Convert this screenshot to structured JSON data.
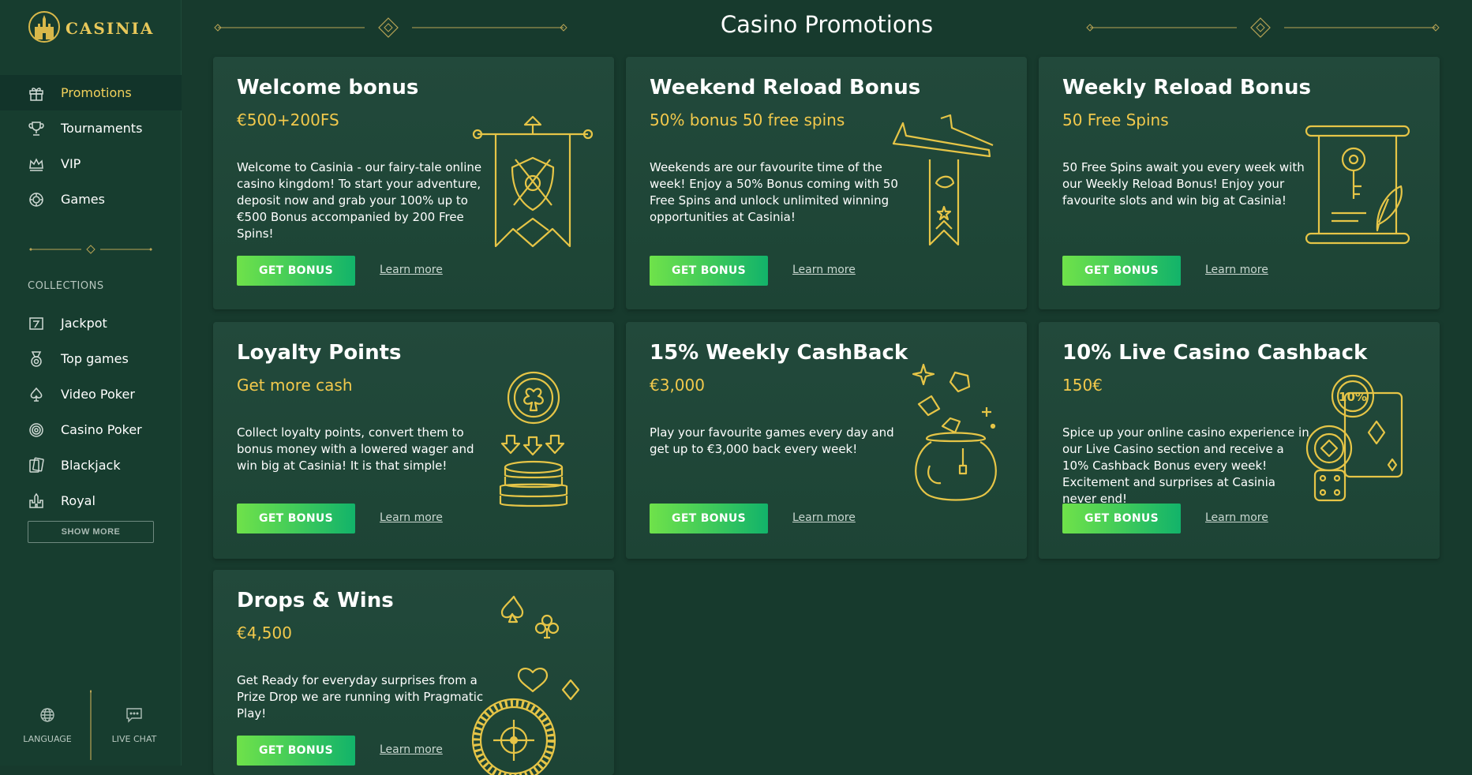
{
  "brand": {
    "logo_text": "CASINIA"
  },
  "nav": {
    "items": [
      {
        "label": "Promotions",
        "icon": "gift-icon",
        "active": true
      },
      {
        "label": "Tournaments",
        "icon": "trophy-icon"
      },
      {
        "label": "VIP",
        "icon": "crown-icon"
      },
      {
        "label": "Games",
        "icon": "chip-icon"
      }
    ]
  },
  "collections": {
    "title": "COLLECTIONS",
    "items": [
      {
        "label": "Jackpot",
        "icon": "slot-seven-icon"
      },
      {
        "label": "Top games",
        "icon": "medal-icon"
      },
      {
        "label": "Video Poker",
        "icon": "spade-icon"
      },
      {
        "label": "Casino Poker",
        "icon": "poker-chip-icon"
      },
      {
        "label": "Blackjack",
        "icon": "cards-icon"
      },
      {
        "label": "Royal",
        "icon": "castle-icon"
      }
    ],
    "show_more": "SHOW MORE"
  },
  "bottom": {
    "language": "LANGUAGE",
    "live_chat": "LIVE CHAT"
  },
  "page": {
    "title": "Casino Promotions"
  },
  "promotions": [
    {
      "title": "Welcome bonus",
      "subtitle": "€500+200FS",
      "description": "Welcome to Casinia - our fairy-tale online casino kingdom! To start your adventure, deposit now and grab your 100% up to €500 Bonus accompanied by 200 Free Spins!",
      "button": "GET BONUS",
      "link": "Learn more",
      "art": "banner-shield-icon"
    },
    {
      "title": "Weekend Reload Bonus",
      "subtitle": "50% bonus 50 free spins",
      "description": "Weekends are our favourite time of the week! Enjoy a 50% Bonus coming with 50 Free Spins and unlock unlimited winning opportunities at Casinia!",
      "button": "GET BONUS",
      "link": "Learn more",
      "art": "trumpets-banner-icon"
    },
    {
      "title": "Weekly Reload Bonus",
      "subtitle": "50 Free Spins",
      "description": "50 Free Spins await you every week with our Weekly Reload Bonus! Enjoy your favourite slots and win big at Casinia!",
      "button": "GET BONUS",
      "link": "Learn more",
      "art": "scroll-key-icon"
    },
    {
      "title": "Loyalty Points",
      "subtitle": "Get more cash",
      "description": "Collect loyalty points, convert them to bonus money with a lowered wager and win big at Casinia! It is that simple!",
      "button": "GET BONUS",
      "link": "Learn more",
      "art": "coins-icon"
    },
    {
      "title": "15% Weekly CashBack",
      "subtitle": "€3,000",
      "description": "Play your favourite games every day and get up to €3,000 back every week!",
      "button": "GET BONUS",
      "link": "Learn more",
      "art": "treasure-pot-icon"
    },
    {
      "title": "10% Live Casino Cashback",
      "subtitle": "150€",
      "description": "Spice up your online casino experience in our Live Casino section and receive a 10% Cashback Bonus every week! Excitement and surprises at Casinia never end!",
      "button": "GET BONUS",
      "link": "Learn more",
      "art": "chips-dice-icon",
      "art_label": "10%"
    },
    {
      "title": "Drops & Wins",
      "subtitle": "€4,500",
      "description": "Get Ready for everyday surprises from a Prize Drop we are running with Pragmatic Play!",
      "button": "GET BONUS",
      "link": "Learn more",
      "art": "roulette-suits-icon"
    }
  ],
  "colors": {
    "accent_gold": "#f2c94c",
    "button_start": "#6fe24a",
    "button_end": "#12b36a",
    "bg": "#173a2d"
  }
}
